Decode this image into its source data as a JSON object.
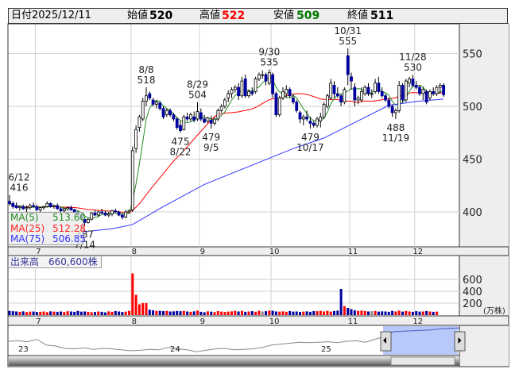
{
  "header": {
    "date_label": "日付",
    "date": "2025/12/11",
    "open_label": "始値",
    "open": "520",
    "high_label": "高値",
    "high": "522",
    "low_label": "安値",
    "low": "509",
    "close_label": "終値",
    "close": "511"
  },
  "colors": {
    "up": "#ffffff",
    "down": "#0000a0",
    "vol_up": "#ff0000",
    "vol_down": "#0000a0",
    "vol_flat": "#888888",
    "ma5": "#228b22",
    "ma25": "#ff0000",
    "ma75": "#3333ff",
    "high_val": "#ff0000",
    "low_val": "#007000"
  },
  "ma_legend": [
    {
      "label": "MA(5)",
      "value": "513.60"
    },
    {
      "label": "MA(25)",
      "value": "512.28"
    },
    {
      "label": "MA(75)",
      "value": "506.85"
    }
  ],
  "volume_label": "出来高　660,600株",
  "chart_data": {
    "type": "candlestick",
    "y_ticks": [
      550,
      500,
      450,
      400
    ],
    "ylim": [
      365,
      575
    ],
    "month_labels": [
      {
        "label": "7",
        "i": 8
      },
      {
        "label": "8",
        "i": 36
      },
      {
        "label": "9",
        "i": 56
      },
      {
        "label": "10",
        "i": 77
      },
      {
        "label": "11",
        "i": 100
      },
      {
        "label": "12",
        "i": 119
      }
    ],
    "ohlc": [
      [
        410,
        416,
        406,
        408
      ],
      [
        408,
        410,
        403,
        405
      ],
      [
        406,
        409,
        403,
        404
      ],
      [
        404,
        406,
        401,
        405
      ],
      [
        405,
        407,
        402,
        403
      ],
      [
        403,
        406,
        400,
        404
      ],
      [
        404,
        408,
        402,
        406
      ],
      [
        406,
        409,
        404,
        405
      ],
      [
        405,
        407,
        401,
        402
      ],
      [
        402,
        405,
        400,
        404
      ],
      [
        404,
        406,
        402,
        405
      ],
      [
        405,
        410,
        404,
        408
      ],
      [
        408,
        409,
        404,
        405
      ],
      [
        405,
        407,
        403,
        406
      ],
      [
        406,
        408,
        402,
        403
      ],
      [
        403,
        405,
        400,
        401
      ],
      [
        401,
        404,
        399,
        403
      ],
      [
        403,
        405,
        401,
        404
      ],
      [
        404,
        406,
        401,
        402
      ],
      [
        402,
        403,
        398,
        399
      ],
      [
        399,
        401,
        396,
        397
      ],
      [
        397,
        398,
        392,
        393
      ],
      [
        393,
        395,
        387,
        390
      ],
      [
        390,
        394,
        389,
        393
      ],
      [
        393,
        400,
        392,
        399
      ],
      [
        399,
        402,
        396,
        397
      ],
      [
        397,
        401,
        395,
        400
      ],
      [
        400,
        403,
        398,
        399
      ],
      [
        399,
        401,
        396,
        397
      ],
      [
        397,
        400,
        395,
        398
      ],
      [
        398,
        402,
        396,
        401
      ],
      [
        401,
        403,
        399,
        400
      ],
      [
        400,
        401,
        396,
        397
      ],
      [
        397,
        399,
        393,
        395
      ],
      [
        395,
        402,
        394,
        400
      ],
      [
        400,
        402,
        398,
        401
      ],
      [
        402,
        462,
        400,
        458
      ],
      [
        460,
        482,
        456,
        478
      ],
      [
        480,
        492,
        476,
        490
      ],
      [
        488,
        508,
        486,
        505
      ],
      [
        505,
        518,
        500,
        510
      ],
      [
        512,
        514,
        506,
        508
      ],
      [
        506,
        508,
        500,
        502
      ],
      [
        502,
        506,
        498,
        504
      ],
      [
        503,
        505,
        496,
        498
      ],
      [
        498,
        500,
        488,
        490
      ],
      [
        492,
        498,
        490,
        496
      ],
      [
        496,
        498,
        490,
        492
      ],
      [
        492,
        494,
        486,
        488
      ],
      [
        488,
        490,
        478,
        480
      ],
      [
        482,
        486,
        475,
        477
      ],
      [
        478,
        492,
        477,
        490
      ],
      [
        490,
        494,
        486,
        488
      ],
      [
        488,
        494,
        486,
        492
      ],
      [
        490,
        495,
        485,
        487
      ],
      [
        488,
        504,
        486,
        495
      ],
      [
        494,
        498,
        486,
        488
      ],
      [
        488,
        492,
        484,
        485
      ],
      [
        486,
        490,
        484,
        489
      ],
      [
        487,
        491,
        479,
        484
      ],
      [
        484,
        490,
        482,
        488
      ],
      [
        488,
        498,
        486,
        496
      ],
      [
        496,
        502,
        494,
        500
      ],
      [
        500,
        508,
        498,
        506
      ],
      [
        508,
        515,
        504,
        512
      ],
      [
        512,
        518,
        508,
        516
      ],
      [
        516,
        520,
        513,
        518
      ],
      [
        518,
        522,
        506,
        510
      ],
      [
        510,
        528,
        508,
        524
      ],
      [
        526,
        530,
        508,
        510
      ],
      [
        510,
        516,
        508,
        514
      ],
      [
        514,
        518,
        510,
        512
      ],
      [
        514,
        528,
        512,
        526
      ],
      [
        526,
        532,
        524,
        530
      ],
      [
        530,
        534,
        526,
        530
      ],
      [
        530,
        532,
        520,
        524
      ],
      [
        522,
        535,
        520,
        532
      ],
      [
        530,
        532,
        508,
        512
      ],
      [
        512,
        514,
        490,
        492
      ],
      [
        492,
        510,
        490,
        508
      ],
      [
        508,
        518,
        506,
        514
      ],
      [
        512,
        520,
        508,
        516
      ],
      [
        516,
        518,
        508,
        510
      ],
      [
        508,
        512,
        502,
        504
      ],
      [
        504,
        506,
        494,
        496
      ],
      [
        494,
        496,
        484,
        488
      ],
      [
        488,
        492,
        482,
        490
      ],
      [
        490,
        496,
        486,
        488
      ],
      [
        486,
        490,
        479,
        484
      ],
      [
        484,
        486,
        480,
        482
      ],
      [
        482,
        490,
        480,
        488
      ],
      [
        486,
        494,
        480,
        490
      ],
      [
        490,
        504,
        488,
        502
      ],
      [
        500,
        512,
        498,
        510
      ],
      [
        508,
        526,
        506,
        522
      ],
      [
        520,
        524,
        508,
        512
      ],
      [
        512,
        518,
        508,
        510
      ],
      [
        510,
        512,
        500,
        504
      ],
      [
        504,
        518,
        502,
        516
      ],
      [
        548,
        555,
        520,
        530
      ],
      [
        528,
        532,
        516,
        524
      ],
      [
        518,
        522,
        500,
        506
      ],
      [
        506,
        510,
        502,
        508
      ],
      [
        506,
        518,
        504,
        514
      ],
      [
        512,
        520,
        510,
        518
      ],
      [
        518,
        522,
        510,
        512
      ],
      [
        512,
        516,
        508,
        512
      ],
      [
        514,
        526,
        512,
        522
      ],
      [
        522,
        528,
        512,
        514
      ],
      [
        514,
        518,
        508,
        510
      ],
      [
        510,
        512,
        504,
        506
      ],
      [
        506,
        508,
        498,
        500
      ],
      [
        500,
        502,
        490,
        494
      ],
      [
        494,
        498,
        488,
        496
      ],
      [
        496,
        524,
        494,
        520
      ],
      [
        520,
        522,
        504,
        506
      ],
      [
        506,
        526,
        504,
        524
      ],
      [
        522,
        528,
        518,
        526
      ],
      [
        526,
        530,
        518,
        520
      ],
      [
        520,
        524,
        516,
        518
      ],
      [
        518,
        520,
        510,
        512
      ],
      [
        512,
        518,
        506,
        516
      ],
      [
        514,
        516,
        502,
        504
      ],
      [
        508,
        516,
        506,
        514
      ],
      [
        514,
        518,
        510,
        512
      ],
      [
        512,
        520,
        510,
        518
      ],
      [
        518,
        522,
        512,
        520
      ],
      [
        520,
        522,
        509,
        511
      ]
    ],
    "volume": [
      70,
      65,
      60,
      55,
      62,
      50,
      58,
      60,
      52,
      55,
      60,
      48,
      62,
      58,
      55,
      60,
      52,
      65,
      60,
      55,
      70,
      58,
      60,
      55,
      48,
      52,
      60,
      55,
      45,
      62,
      55,
      68,
      60,
      52,
      58,
      70,
      700,
      340,
      180,
      200,
      200,
      90,
      80,
      70,
      72,
      66,
      70,
      60,
      62,
      68,
      65,
      70,
      60,
      55,
      62,
      75,
      55,
      48,
      62,
      58,
      50,
      66,
      58,
      52,
      58,
      62,
      72,
      60,
      70,
      55,
      60,
      65,
      56,
      72,
      60,
      65,
      75,
      72,
      60,
      58,
      62,
      55,
      66,
      58,
      60,
      52,
      58,
      62,
      55,
      66,
      65,
      70,
      60,
      72,
      58,
      68,
      75,
      440,
      150,
      120,
      100,
      80,
      70,
      75,
      68,
      60,
      65,
      68,
      58,
      62,
      60,
      55,
      70,
      60,
      75,
      58,
      68,
      60,
      55,
      65,
      58,
      60,
      68,
      60,
      55,
      58
    ],
    "ma75": [
      {
        "i": 21,
        "v": 381
      },
      {
        "i": 30,
        "v": 384
      },
      {
        "i": 36,
        "v": 388
      },
      {
        "i": 45,
        "v": 405
      },
      {
        "i": 57,
        "v": 426
      },
      {
        "i": 70,
        "v": 443
      },
      {
        "i": 83,
        "v": 460
      },
      {
        "i": 92,
        "v": 470
      },
      {
        "i": 100,
        "v": 483
      },
      {
        "i": 111,
        "v": 501
      },
      {
        "i": 120,
        "v": 505
      },
      {
        "i": 127,
        "v": 506.85
      }
    ],
    "annotations": [
      {
        "i": 0,
        "date": "6/12",
        "price": "416",
        "pos": "above"
      },
      {
        "i": 40,
        "date": "8/8",
        "price": "518",
        "pos": "above"
      },
      {
        "i": 50,
        "date": "8/22",
        "price": "475",
        "pos": "below"
      },
      {
        "i": 55,
        "date": "8/29",
        "price": "504",
        "pos": "above"
      },
      {
        "i": 59,
        "date": "9/5",
        "price": "479",
        "pos": "below"
      },
      {
        "i": 76,
        "date": "9/30",
        "price": "535",
        "pos": "above"
      },
      {
        "i": 88,
        "date": "10/17",
        "price": "479",
        "pos": "below"
      },
      {
        "i": 99,
        "date": "10/31",
        "price": "555",
        "pos": "above"
      },
      {
        "i": 113,
        "date": "11/19",
        "price": "488",
        "pos": "below"
      },
      {
        "i": 118,
        "date": "11/28",
        "price": "530",
        "pos": "above"
      },
      {
        "i": 22,
        "date": "7/14",
        "price": "387",
        "pos": "below"
      }
    ],
    "volume_ticks": [
      600,
      400,
      200
    ],
    "volume_unit": "(万株)",
    "navigator": {
      "years": [
        "23",
        "24",
        "25"
      ],
      "values": [
        420,
        421,
        419,
        424,
        412,
        410,
        405,
        404,
        406,
        403,
        405,
        404,
        402,
        400,
        401,
        403,
        402,
        407,
        404,
        402,
        398,
        401,
        404,
        405,
        402,
        403,
        404,
        407,
        412,
        414,
        416,
        418,
        417,
        418,
        419,
        417,
        420,
        421,
        418,
        424,
        430,
        440,
        441,
        442,
        443,
        444,
        446,
        447,
        448
      ]
    }
  }
}
